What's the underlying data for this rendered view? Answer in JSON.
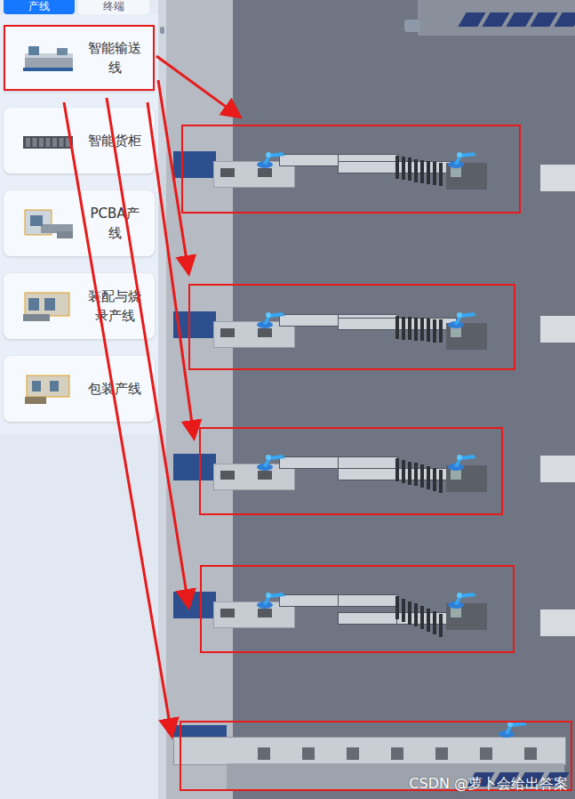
{
  "tabs": [
    {
      "label": "产线",
      "selected": true
    },
    {
      "label": "终端",
      "selected": false
    }
  ],
  "sidebar": {
    "items": [
      {
        "label": "智能输送线",
        "selected": true
      },
      {
        "label": "智能货柜",
        "selected": false
      },
      {
        "label": "PCBA产线",
        "selected": false
      },
      {
        "label": "装配与烧录产线",
        "selected": false
      },
      {
        "label": "包装产线",
        "selected": false
      }
    ]
  },
  "watermark": "CSDN @萝卜会给出答案"
}
